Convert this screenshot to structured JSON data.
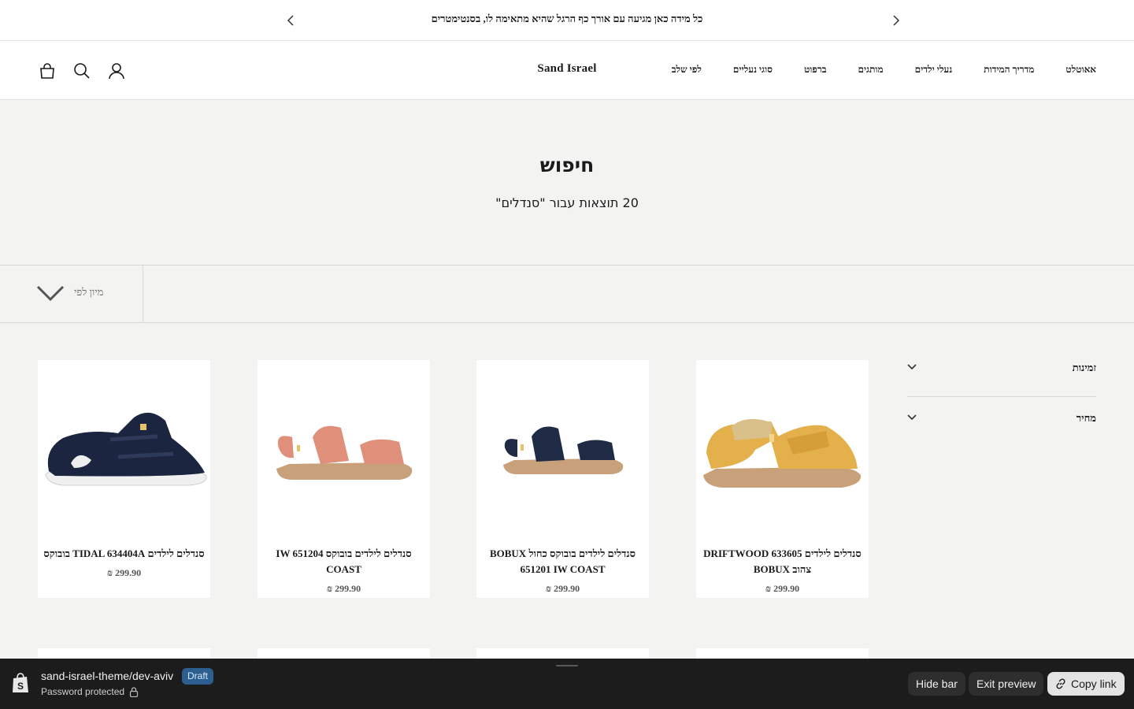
{
  "announcement": {
    "text": "כל מידה כאן מגיעה עם אורך כף הרגל שהיא מתאימה לו, בסנטימטרים"
  },
  "header": {
    "logo": "Sand Israel",
    "nav": [
      "לפי שלב",
      "סוגי נעליים",
      "ברפוט",
      "מותגים",
      "נעלי ילדים",
      "מדריך המידות",
      "אאוטלט"
    ],
    "icons": [
      "cart-icon",
      "search-icon",
      "account-icon"
    ]
  },
  "hero": {
    "title": "חיפוש",
    "count_text": "20 תוצאות עבור \"סנדלים\""
  },
  "sort": {
    "label": "מיון לפי"
  },
  "filters": [
    {
      "label": "זמינות"
    },
    {
      "label": "מחיר"
    }
  ],
  "products": [
    {
      "title": "סנדלים לילדים DRIFTWOOD 633605 צהוב BOBUX",
      "price": "₪ 299.90",
      "color": "#e3b04b"
    },
    {
      "title": "סנדלים לילדים בובוקס כחול BOBUX 651201 IW COAST",
      "price": "₪ 299.90",
      "color": "#1f2a44"
    },
    {
      "title": "סנדלים לילדים בובוקס IW 651204 COAST",
      "price": "₪ 299.90",
      "color": "#e0907a"
    },
    {
      "title": "סנדלים לילדים TIDAL 634404A בובוקס",
      "price": "₪ 299.90",
      "color": "#1c2540"
    }
  ],
  "preview_bar": {
    "theme": "sand-israel-theme/dev-aviv",
    "badge": "Draft",
    "password_text": "Password protected",
    "hide_bar": "Hide bar",
    "exit_preview": "Exit preview",
    "copy_link": "Copy link"
  }
}
